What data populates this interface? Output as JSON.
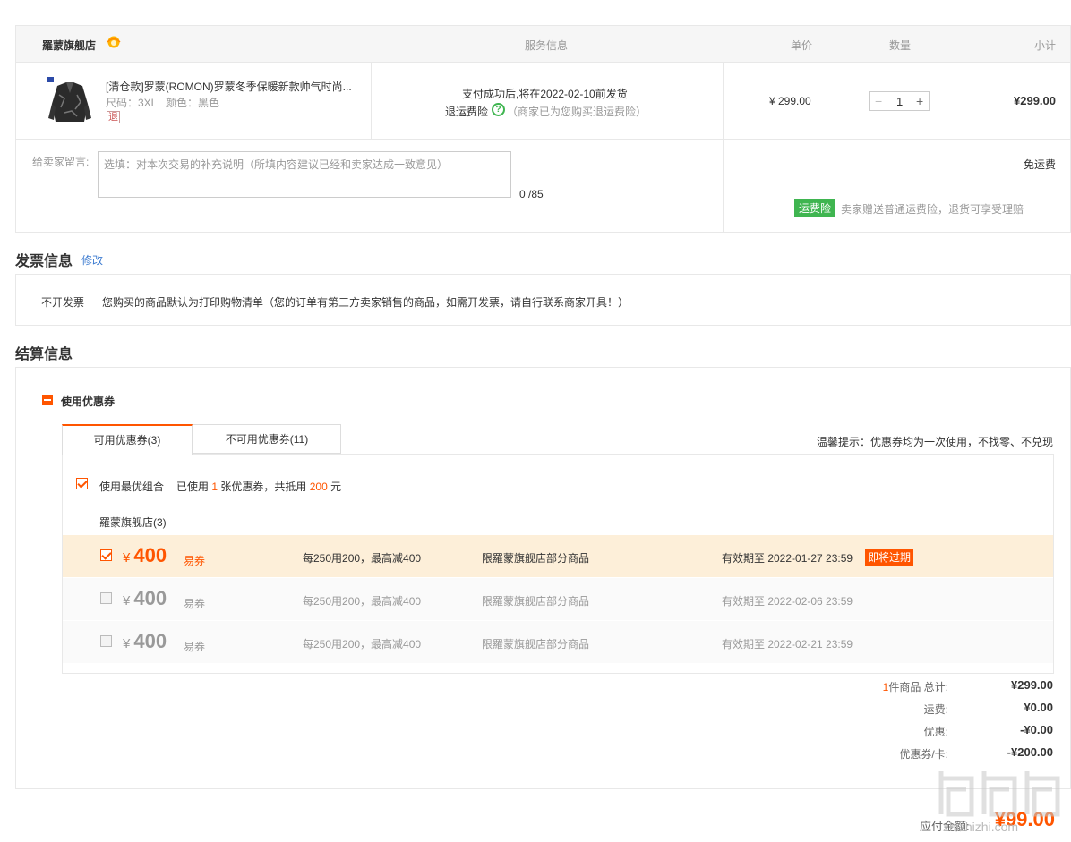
{
  "header": {
    "store": "羅蒙旗舰店",
    "service_col": "服务信息",
    "price_col": "单价",
    "qty_col": "数量",
    "subtotal_col": "小计"
  },
  "item": {
    "title": "[清仓款]罗蒙(ROMON)罗蒙冬季保暖新款帅气时尚...",
    "size": "尺码：3XL",
    "color": "颜色：黑色",
    "return_tag": "退",
    "ship_info": "支付成功后,将在2022-02-10前发货",
    "insurance_label": "退运费险",
    "insurance_note": "（商家已为您购买退运费险）",
    "unit_price": "¥ 299.00",
    "qty": "1",
    "qty_minus": "−",
    "qty_plus": "+",
    "subtotal": "¥299.00"
  },
  "message": {
    "label": "给卖家留言:",
    "placeholder": "选填：对本次交易的补充说明（所填内容建议已经和卖家达成一致意见）",
    "count": "0 /85",
    "free_shipping": "免运费",
    "insurance_badge": "运费险",
    "insurance_text": "卖家赠送普通运费险，退货可享受理赔"
  },
  "invoice": {
    "title": "发票信息",
    "edit": "修改",
    "type": "不开发票",
    "desc": "您购买的商品默认为打印购物清单（您的订单有第三方卖家销售的商品，如需开发票，请自行联系商家开具！）"
  },
  "settlement": {
    "title": "结算信息",
    "coupon_toggle": "使用优惠券",
    "tab_available": "可用优惠券(3)",
    "tab_unavailable": "不可用优惠券(11)",
    "tip": "温馨提示：优惠券均为一次使用，不找零、不兑现",
    "best_combo": "使用最优组合",
    "used_prefix": "已使用",
    "used_count": "1",
    "used_mid": "张优惠券，共抵用",
    "used_amount": "200",
    "used_suffix": "元",
    "store_group": "羅蒙旗舰店(3)",
    "coupons": [
      {
        "currency": "¥",
        "amount": "400",
        "tag": "易券",
        "rule": "每250用200，最高减400",
        "scope": "限羅蒙旗舰店部分商品",
        "validity": "有效期至 2022-01-27 23:59",
        "badge": "即将过期",
        "checked": true
      },
      {
        "currency": "¥",
        "amount": "400",
        "tag": "易券",
        "rule": "每250用200，最高减400",
        "scope": "限羅蒙旗舰店部分商品",
        "validity": "有效期至 2022-02-06 23:59",
        "badge": "",
        "checked": false
      },
      {
        "currency": "¥",
        "amount": "400",
        "tag": "易券",
        "rule": "每250用200，最高减400",
        "scope": "限羅蒙旗舰店部分商品",
        "validity": "有效期至 2022-02-21 23:59",
        "badge": "",
        "checked": false
      }
    ]
  },
  "summary": {
    "count_num": "1",
    "count_label": "件商品 总计:",
    "total": "¥299.00",
    "shipping_label": "运费:",
    "shipping": "¥0.00",
    "discount_label": "优惠:",
    "discount": "-¥0.00",
    "coupon_label": "优惠券/卡:",
    "coupon": "-¥200.00",
    "payable_label": "应付金额:",
    "payable": "¥99.00"
  },
  "watermark": "zhizhizhi.com",
  "colors": {
    "accent": "#ff5500",
    "green": "#3fb550",
    "highlight": "#fdefd9"
  }
}
